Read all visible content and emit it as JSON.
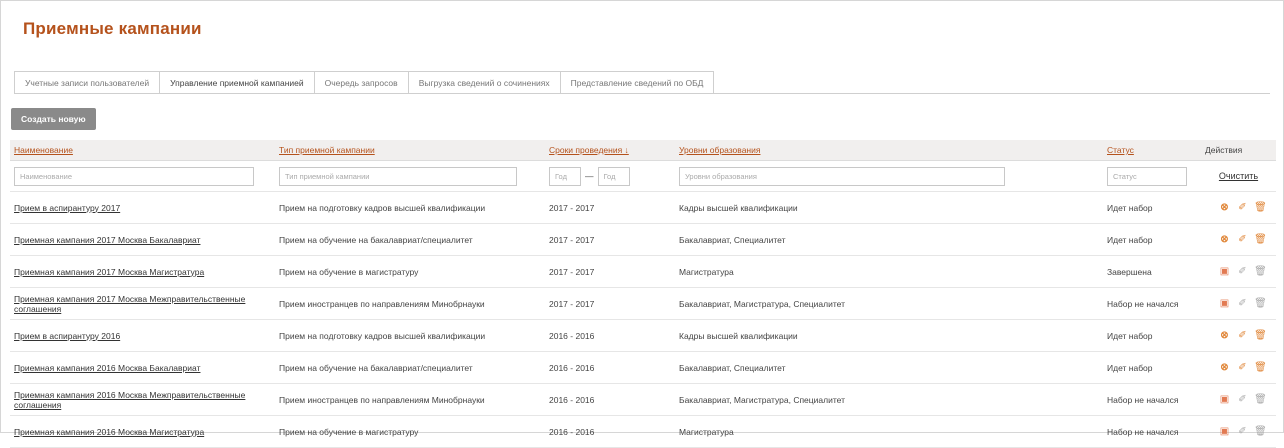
{
  "page": {
    "title": "Приемные кампании"
  },
  "tabs": [
    {
      "label": "Учетные записи пользователей"
    },
    {
      "label": "Управление приемной кампанией"
    },
    {
      "label": "Очередь запросов"
    },
    {
      "label": "Выгрузка сведений о сочинениях"
    },
    {
      "label": "Представление сведений по ОБД"
    }
  ],
  "toolbar": {
    "create_label": "Создать новую"
  },
  "columns": {
    "name": "Наименование",
    "type": "Тип приемной кампании",
    "period": "Сроки проведения ↓",
    "level": "Уровни образования",
    "status": "Статус",
    "actions": "Действия"
  },
  "filters": {
    "name_placeholder": "Наименование",
    "type_placeholder": "Тип приемной кампании",
    "year_from_placeholder": "Год",
    "year_to_placeholder": "Год",
    "level_placeholder": "Уровни образования",
    "status_placeholder": "Статус",
    "clear_label": "Очистить",
    "dash": "—"
  },
  "rows": [
    {
      "name": "Прием в аспирантуру 2017",
      "type": "Прием на подготовку кадров высшей квалификации",
      "period": "2017 - 2017",
      "level": "Кадры высшей квалификации",
      "status": "Идет набор",
      "icons": [
        "cancel-icon",
        "edit-icon",
        "delete-icon"
      ]
    },
    {
      "name": "Приемная кампания 2017 Москва Бакалавриат",
      "type": "Прием на обучение на бакалавриат/специалитет",
      "period": "2017 - 2017",
      "level": "Бакалавриат, Специалитет",
      "status": "Идет набор",
      "icons": [
        "cancel-icon",
        "edit-icon",
        "delete-icon"
      ]
    },
    {
      "name": "Приемная кампания 2017 Москва Магистратура",
      "type": "Прием на обучение в магистратуру",
      "period": "2017 - 2017",
      "level": "Магистратура",
      "status": "Завершена",
      "icons": [
        "document-icon",
        "edit-icon",
        "delete-icon"
      ]
    },
    {
      "name": "Приемная кампания 2017 Москва Межправительственные соглашения",
      "type": "Прием иностранцев по направлениям Минобрнауки",
      "period": "2017 - 2017",
      "level": "Бакалавриат, Магистратура, Специалитет",
      "status": "Набор не начался",
      "icons": [
        "document-icon",
        "edit-icon",
        "delete-icon"
      ]
    },
    {
      "name": "Прием в аспирантуру 2016",
      "type": "Прием на подготовку кадров высшей квалификации",
      "period": "2016 - 2016",
      "level": "Кадры высшей квалификации",
      "status": "Идет набор",
      "icons": [
        "cancel-icon",
        "edit-icon",
        "delete-icon"
      ]
    },
    {
      "name": "Приемная кампания 2016 Москва Бакалавриат",
      "type": "Прием на обучение на бакалавриат/специалитет",
      "period": "2016 - 2016",
      "level": "Бакалавриат, Специалитет",
      "status": "Идет набор",
      "icons": [
        "cancel-icon",
        "edit-icon",
        "delete-icon"
      ]
    },
    {
      "name": "Приемная кампания 2016 Москва Межправительственные соглашения",
      "type": "Прием иностранцев по направлениям Минобрнауки",
      "period": "2016 - 2016",
      "level": "Бакалавриат, Магистратура, Специалитет",
      "status": "Набор не начался",
      "icons": [
        "document-icon",
        "edit-icon",
        "delete-icon"
      ]
    },
    {
      "name": "Приемная кампания 2016 Москва Магистратура",
      "type": "Прием на обучение в магистратуру",
      "period": "2016 - 2016",
      "level": "Магистратура",
      "status": "Набор не начался",
      "icons": [
        "document-icon",
        "edit-icon",
        "delete-icon"
      ]
    }
  ]
}
